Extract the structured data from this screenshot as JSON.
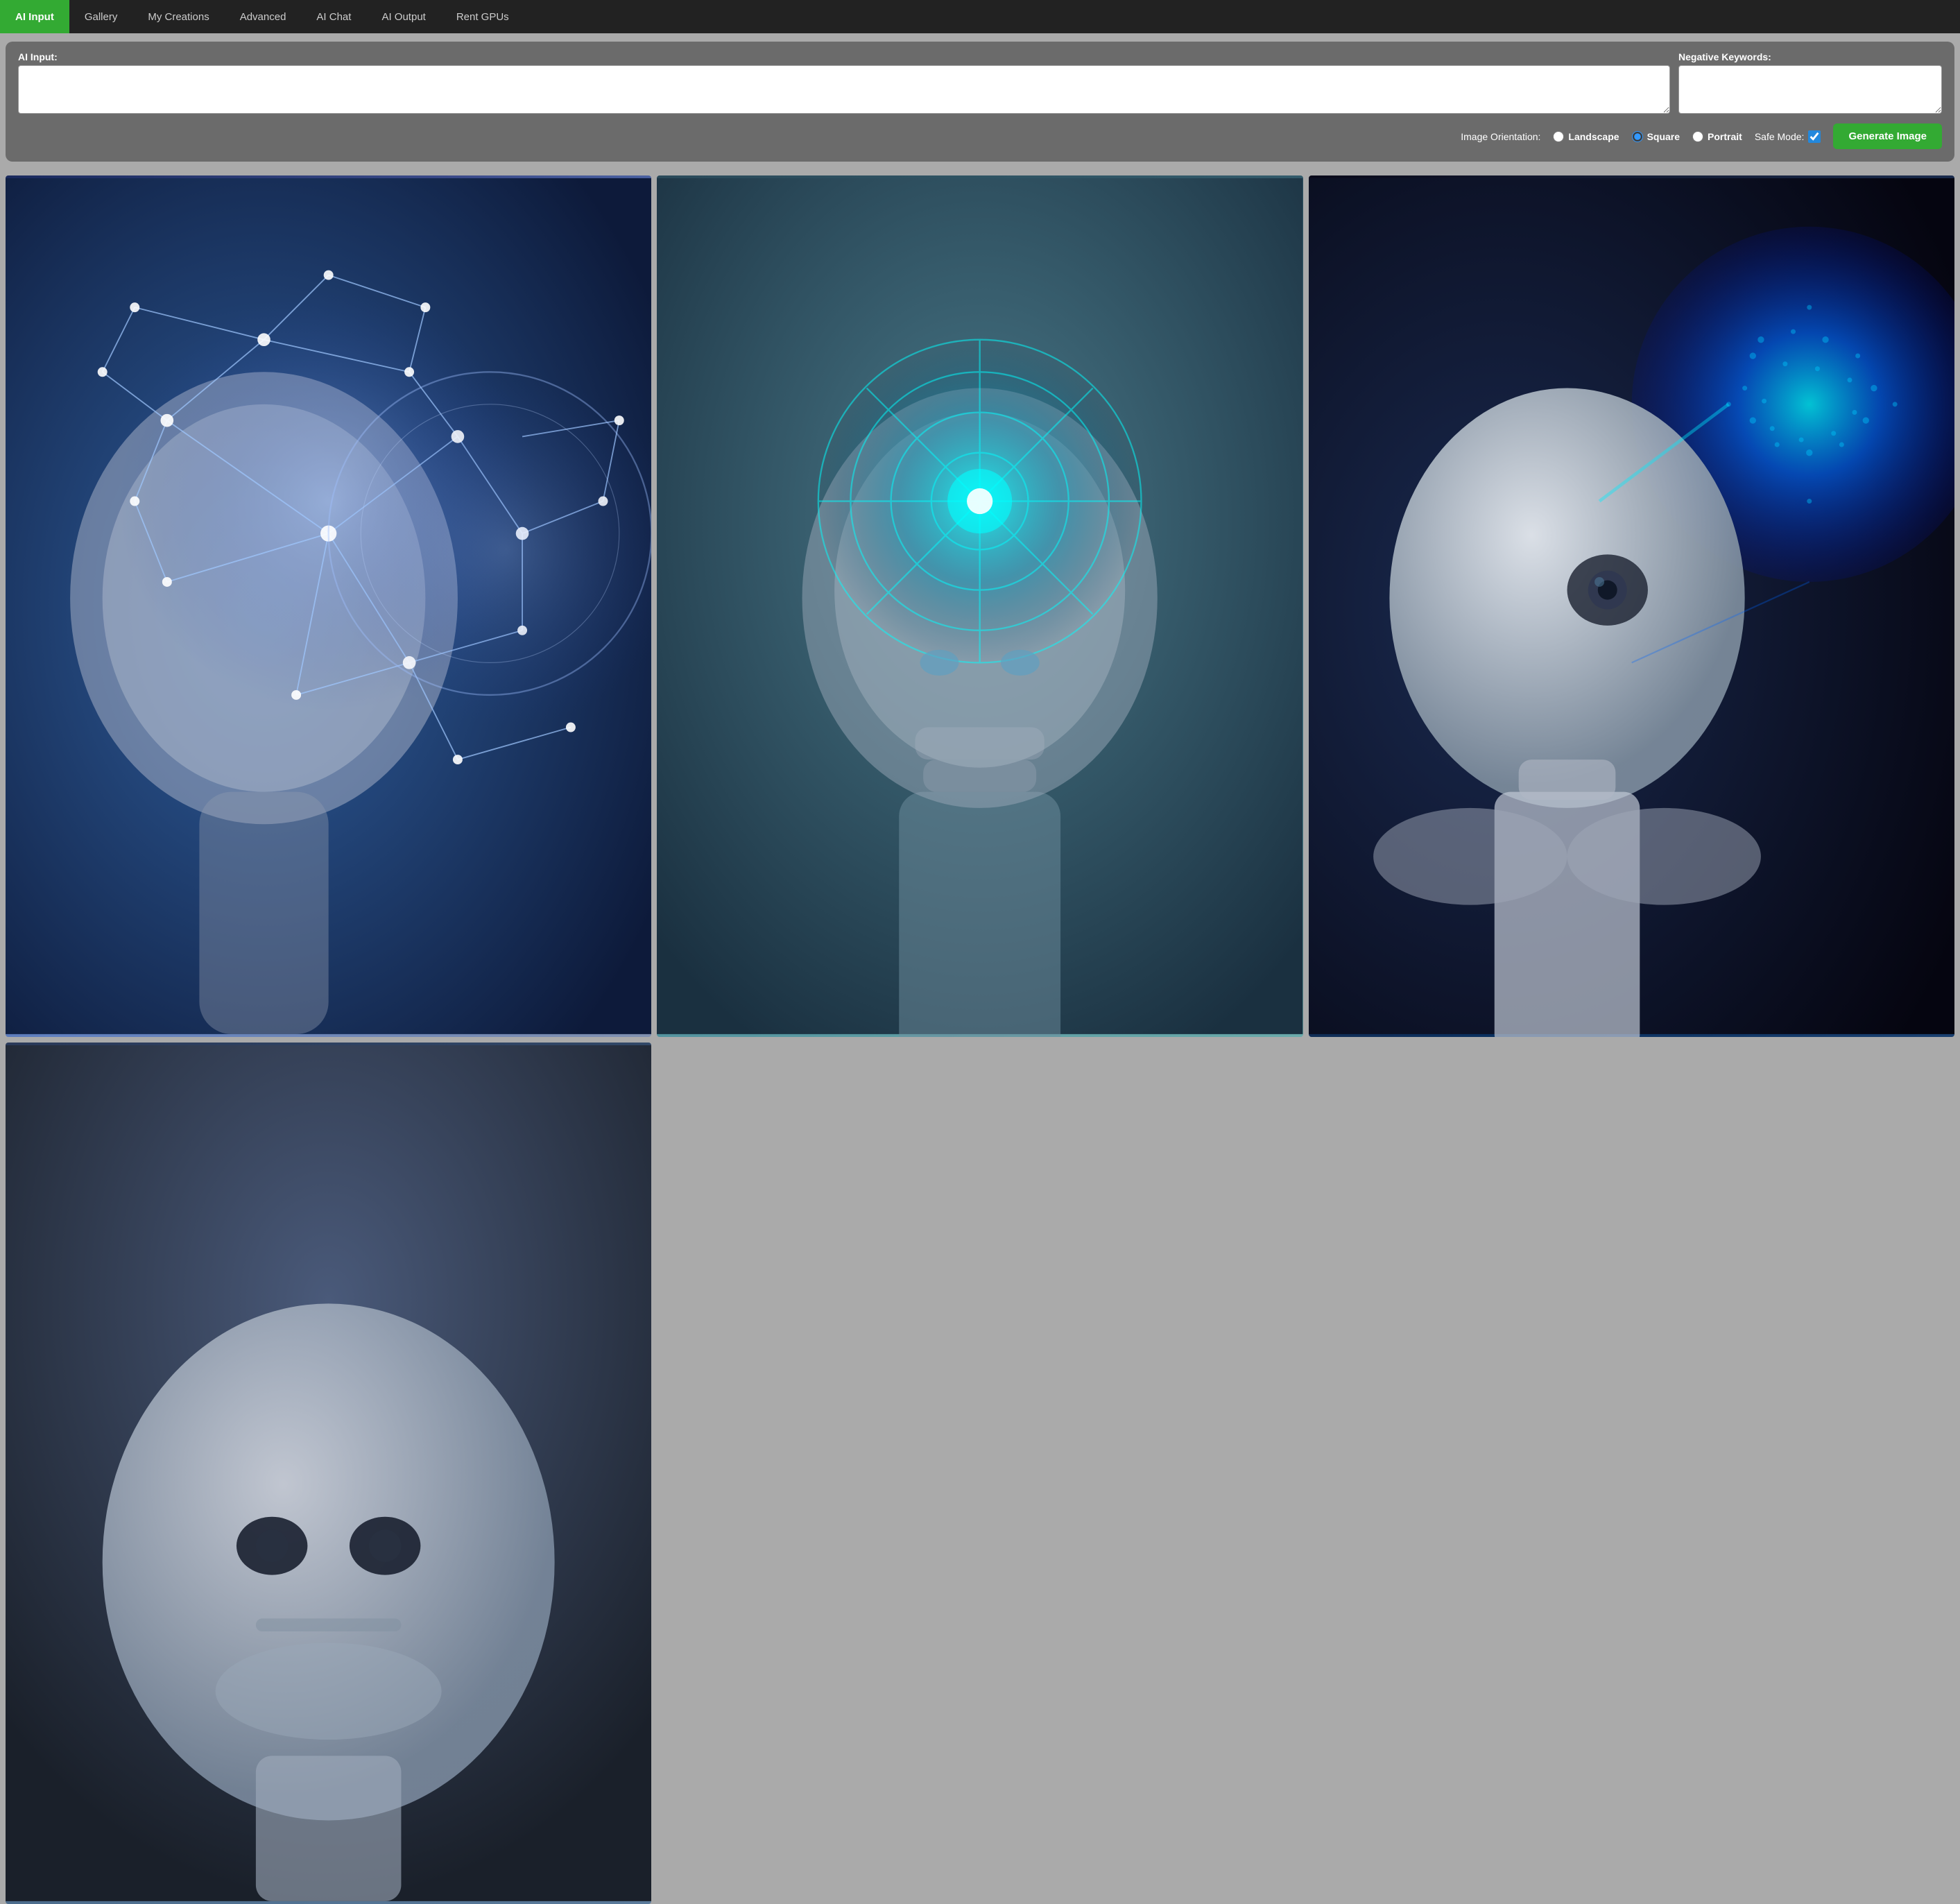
{
  "nav": {
    "items": [
      {
        "id": "ai-input",
        "label": "AI Input",
        "active": true
      },
      {
        "id": "gallery",
        "label": "Gallery",
        "active": false
      },
      {
        "id": "my-creations",
        "label": "My Creations",
        "active": false
      },
      {
        "id": "advanced",
        "label": "Advanced",
        "active": false
      },
      {
        "id": "ai-chat",
        "label": "AI Chat",
        "active": false
      },
      {
        "id": "ai-output",
        "label": "AI Output",
        "active": false
      },
      {
        "id": "rent-gpus",
        "label": "Rent GPUs",
        "active": false
      }
    ]
  },
  "control_panel": {
    "ai_input_label": "AI Input:",
    "ai_input_placeholder": "",
    "negative_keywords_label": "Negative Keywords:",
    "negative_keywords_placeholder": "",
    "image_orientation_label": "Image Orientation:",
    "orientations": [
      {
        "id": "landscape",
        "label": "Landscape",
        "checked": false
      },
      {
        "id": "square",
        "label": "Square",
        "checked": true
      },
      {
        "id": "portrait",
        "label": "Portrait",
        "checked": false
      }
    ],
    "safe_mode_label": "Safe Mode:",
    "safe_mode_checked": true,
    "generate_button_label": "Generate Image"
  },
  "images": [
    {
      "id": "robot-1",
      "alt": "AI robot with neural network visualization"
    },
    {
      "id": "robot-2",
      "alt": "AI robot with glowing brain scan"
    },
    {
      "id": "robot-3",
      "alt": "White AI robot with glowing sphere"
    },
    {
      "id": "robot-4",
      "alt": "AI robot portrait"
    }
  ]
}
